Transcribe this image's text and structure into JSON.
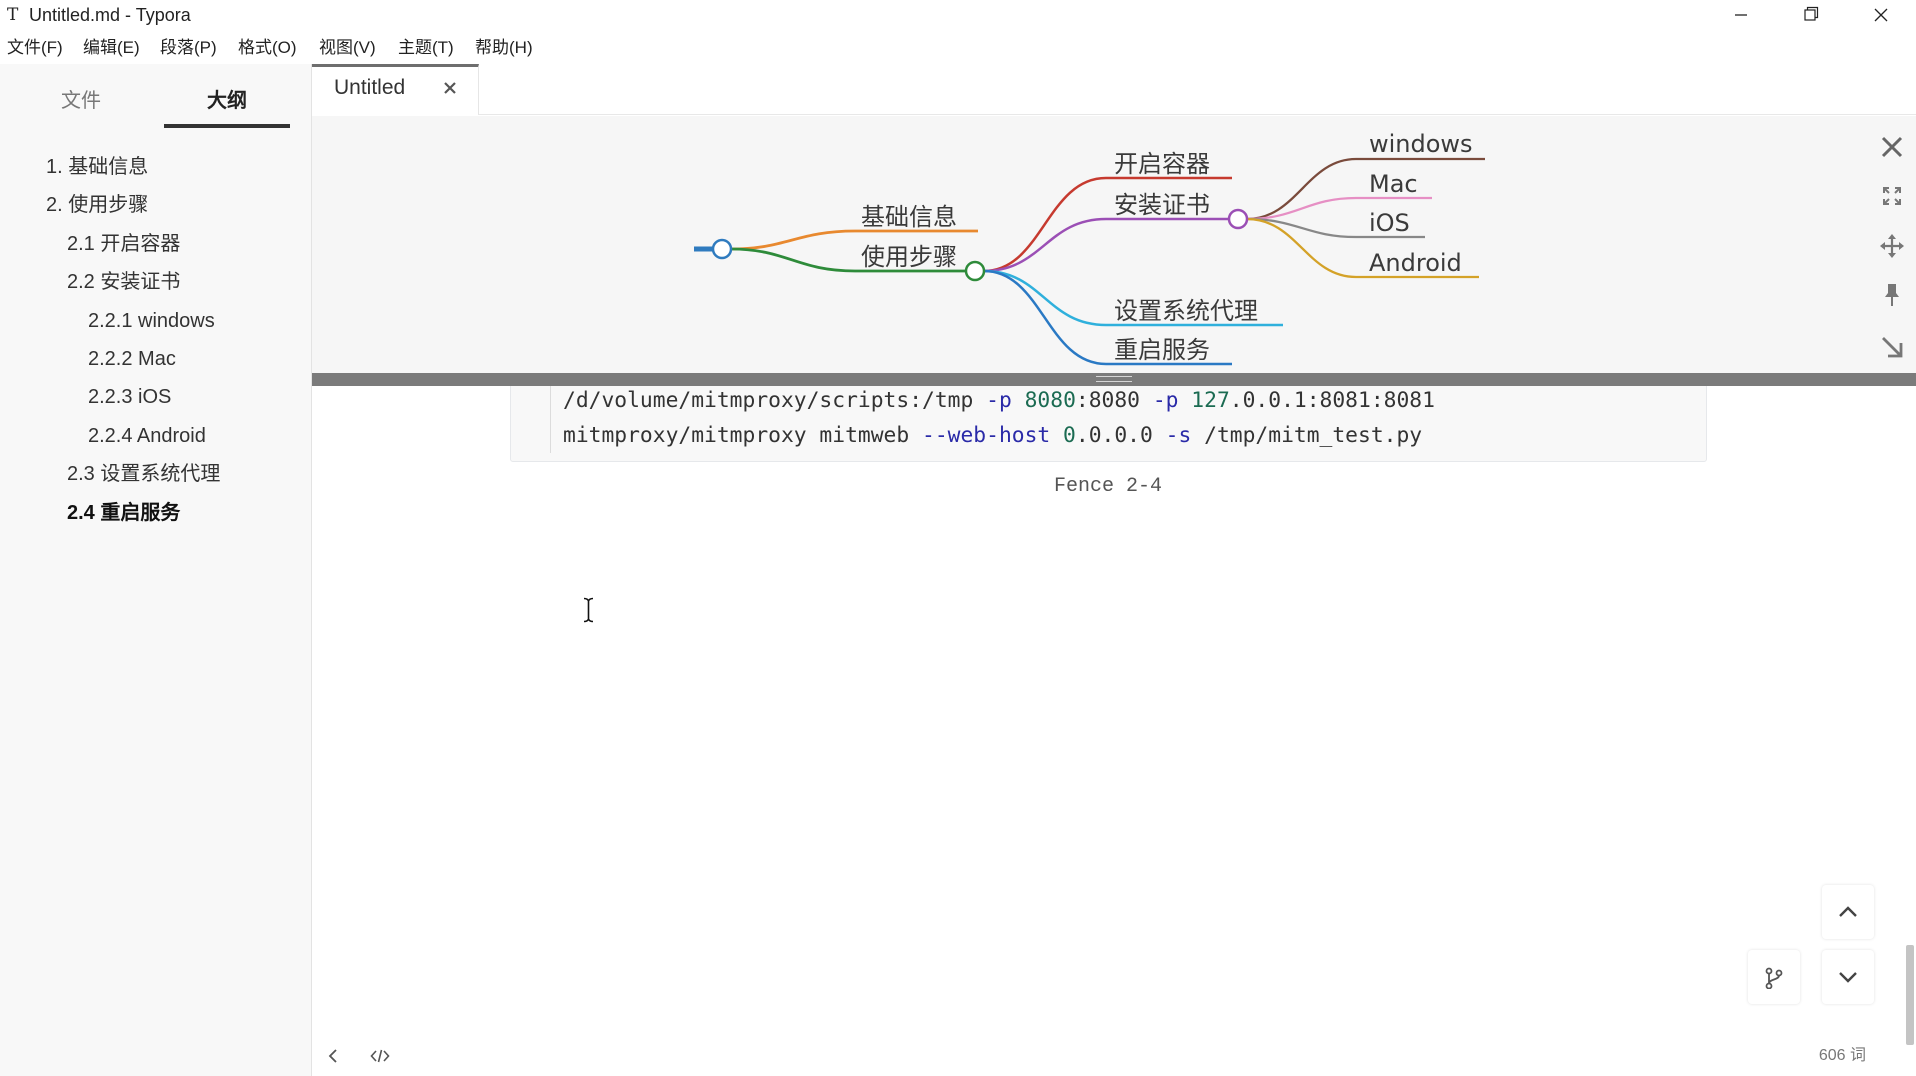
{
  "window": {
    "icon_glyph": "T",
    "title": "Untitled.md - Typora",
    "controls": [
      {
        "icon": "minimize-icon"
      },
      {
        "icon": "restore-icon"
      },
      {
        "icon": "close-icon"
      }
    ]
  },
  "menu": {
    "items": [
      {
        "label": "文件(F)"
      },
      {
        "label": "编辑(E)"
      },
      {
        "label": "段落(P)"
      },
      {
        "label": "格式(O)"
      },
      {
        "label": "视图(V)"
      },
      {
        "label": "主题(T)"
      },
      {
        "label": "帮助(H)"
      }
    ]
  },
  "sidebar": {
    "tabs": [
      {
        "label": "文件",
        "active": false
      },
      {
        "label": "大纲",
        "active": true
      }
    ],
    "outline": [
      {
        "label": "1. 基础信息",
        "active": false
      },
      {
        "label": "2. 使用步骤",
        "active": false
      },
      {
        "label": "2.1 开启容器",
        "active": false
      },
      {
        "label": "2.2 安装证书",
        "active": false
      },
      {
        "label": "2.2.1 windows",
        "active": false
      },
      {
        "label": "2.2.2 Mac",
        "active": false
      },
      {
        "label": "2.2.3 iOS",
        "active": false
      },
      {
        "label": "2.2.4 Android",
        "active": false
      },
      {
        "label": "2.3 设置系统代理",
        "active": false
      },
      {
        "label": "2.4 重启服务",
        "active": true
      }
    ]
  },
  "editor": {
    "tab": {
      "label": "Untitled",
      "close_icon": "close-icon"
    },
    "mindmap": {
      "toolbar": [
        {
          "icon": "close-icon"
        },
        {
          "icon": "fullscreen-icon"
        },
        {
          "icon": "move-icon"
        },
        {
          "icon": "pin-icon"
        },
        {
          "icon": "collapse-arrow-icon"
        }
      ],
      "root_color": "#2f7bbf",
      "nodes": [
        {
          "label": "基础信息",
          "color": "#e8892f"
        },
        {
          "label": "使用步骤",
          "color": "#2e8b3a"
        },
        {
          "label": "开启容器",
          "color": "#c63a2f"
        },
        {
          "label": "安装证书",
          "color": "#9b4fb5"
        },
        {
          "label": "设置系统代理",
          "color": "#2fb0dc"
        },
        {
          "label": "重启服务",
          "color": "#2a79c4"
        },
        {
          "label": "windows",
          "color": "#7a4b3c"
        },
        {
          "label": "Mac",
          "color": "#e68fc4"
        },
        {
          "label": "iOS",
          "color": "#888888"
        },
        {
          "label": "Android",
          "color": "#d4a228"
        }
      ]
    },
    "code_block": {
      "lines": [
        [
          {
            "text": "/d/volume/mitmproxy/scripts:/tmp ",
            "color": "#333333"
          },
          {
            "text": "-p",
            "color": "#2a2aa8"
          },
          {
            "text": " 8080",
            "color": "#1b6b52"
          },
          {
            "text": ":8080 ",
            "color": "#333333"
          },
          {
            "text": "-p",
            "color": "#2a2aa8"
          },
          {
            "text": " 127",
            "color": "#1b6b52"
          },
          {
            "text": ".0.0.1:8081:8081",
            "color": "#333333"
          }
        ],
        [
          {
            "text": "mitmproxy/mitmproxy mitmweb ",
            "color": "#333333"
          },
          {
            "text": "--web-host",
            "color": "#2a2aa8"
          },
          {
            "text": " 0",
            "color": "#1b6b52"
          },
          {
            "text": ".0.0.0 ",
            "color": "#333333"
          },
          {
            "text": "-s",
            "color": "#2a2aa8"
          },
          {
            "text": " /tmp/mitm_test.py",
            "color": "#333333"
          }
        ]
      ],
      "caption": "Fence 2-4"
    }
  },
  "status_bar": {
    "left_icons": [
      {
        "icon": "chevron-left-icon"
      },
      {
        "icon": "source-code-icon"
      }
    ],
    "word_count": "606 词"
  },
  "floating_controls": [
    {
      "icon": "scroll-up-icon"
    },
    {
      "icon": "scroll-down-icon"
    },
    {
      "icon": "branch-icon"
    }
  ]
}
